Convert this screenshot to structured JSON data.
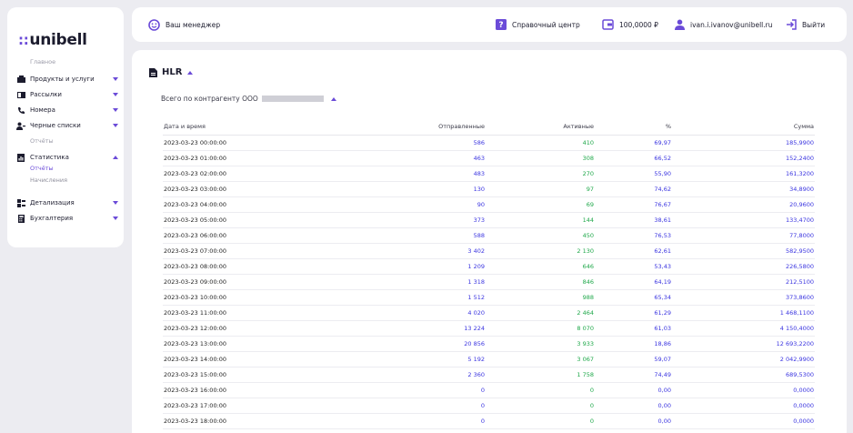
{
  "brand": {
    "logo_dots": "::",
    "logo_text": "unibell"
  },
  "sidebar": {
    "section_main": "Главное",
    "section_reports": "Отчёты",
    "items": [
      {
        "label": "Продукты и услуги",
        "icon": "cart-icon",
        "chevron": "down"
      },
      {
        "label": "Рассылки",
        "icon": "mail-icon",
        "chevron": "down"
      },
      {
        "label": "Номера",
        "icon": "phone-icon",
        "chevron": "down"
      },
      {
        "label": "Черные списки",
        "icon": "user-block-icon",
        "chevron": "down"
      },
      {
        "label": "Статистика",
        "icon": "stats-icon",
        "chevron": "up"
      },
      {
        "label": "Детализация",
        "icon": "detail-icon",
        "chevron": "down"
      },
      {
        "label": "Бухгалтерия",
        "icon": "accounting-icon",
        "chevron": "down"
      }
    ],
    "sub_items": [
      {
        "label": "Отчёты",
        "active": true
      },
      {
        "label": "Начисления",
        "active": false
      }
    ]
  },
  "header": {
    "manager": "Ваш менеджер",
    "help": "Справочный центр",
    "balance": "100,0000 ₽",
    "email": "ivan.i.ivanov@unibell.ru",
    "logout": "Выйти"
  },
  "main": {
    "title": "HLR",
    "contractor_prefix": "Всего по контрагенту ООО",
    "table": {
      "columns": [
        "Дата и время",
        "Отправленные",
        "Активные",
        "%",
        "Сумма"
      ],
      "rows": [
        [
          "2023-03-23 00:00:00",
          "586",
          "410",
          "69,97",
          "185,9900"
        ],
        [
          "2023-03-23 01:00:00",
          "463",
          "308",
          "66,52",
          "152,2400"
        ],
        [
          "2023-03-23 02:00:00",
          "483",
          "270",
          "55,90",
          "161,3200"
        ],
        [
          "2023-03-23 03:00:00",
          "130",
          "97",
          "74,62",
          "34,8900"
        ],
        [
          "2023-03-23 04:00:00",
          "90",
          "69",
          "76,67",
          "20,9600"
        ],
        [
          "2023-03-23 05:00:00",
          "373",
          "144",
          "38,61",
          "133,4700"
        ],
        [
          "2023-03-23 06:00:00",
          "588",
          "450",
          "76,53",
          "77,8000"
        ],
        [
          "2023-03-23 07:00:00",
          "3 402",
          "2 130",
          "62,61",
          "582,9500"
        ],
        [
          "2023-03-23 08:00:00",
          "1 209",
          "646",
          "53,43",
          "226,5800"
        ],
        [
          "2023-03-23 09:00:00",
          "1 318",
          "846",
          "64,19",
          "212,5100"
        ],
        [
          "2023-03-23 10:00:00",
          "1 512",
          "988",
          "65,34",
          "373,8600"
        ],
        [
          "2023-03-23 11:00:00",
          "4 020",
          "2 464",
          "61,29",
          "1 468,1100"
        ],
        [
          "2023-03-23 12:00:00",
          "13 224",
          "8 070",
          "61,03",
          "4 150,4000"
        ],
        [
          "2023-03-23 13:00:00",
          "20 856",
          "3 933",
          "18,86",
          "12 693,2200"
        ],
        [
          "2023-03-23 14:00:00",
          "5 192",
          "3 067",
          "59,07",
          "2 042,9900"
        ],
        [
          "2023-03-23 15:00:00",
          "2 360",
          "1 758",
          "74,49",
          "689,5300"
        ],
        [
          "2023-03-23 16:00:00",
          "0",
          "0",
          "0,00",
          "0,0000"
        ],
        [
          "2023-03-23 17:00:00",
          "0",
          "0",
          "0,00",
          "0,0000"
        ],
        [
          "2023-03-23 18:00:00",
          "0",
          "0",
          "0,00",
          "0,0000"
        ]
      ]
    }
  },
  "colors": {
    "accent": "#6b4bd8",
    "sent": "#3b35e0",
    "active": "#1fa84a",
    "background": "#ececf1"
  }
}
